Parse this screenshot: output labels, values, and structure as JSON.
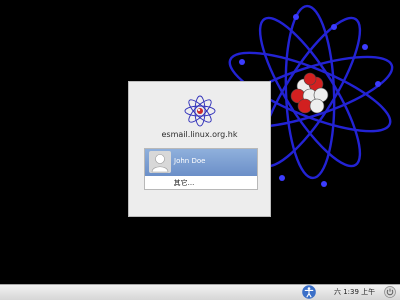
{
  "login": {
    "hostname": "esmail.linux.org.hk",
    "users": [
      {
        "name": "John Doe",
        "selected": true
      }
    ],
    "other_label": "其它..."
  },
  "panel": {
    "clock": "六  1:39 上午"
  },
  "icons": {
    "logo": "atom-logo-icon",
    "avatar": "user-avatar-icon",
    "accessibility": "accessibility-icon",
    "power": "power-icon"
  },
  "colors": {
    "selection": "#7a9dd2",
    "panel": "#e2e2e2",
    "dialog": "#ededed",
    "wallpaper_orbit": "#2a2ad8"
  }
}
